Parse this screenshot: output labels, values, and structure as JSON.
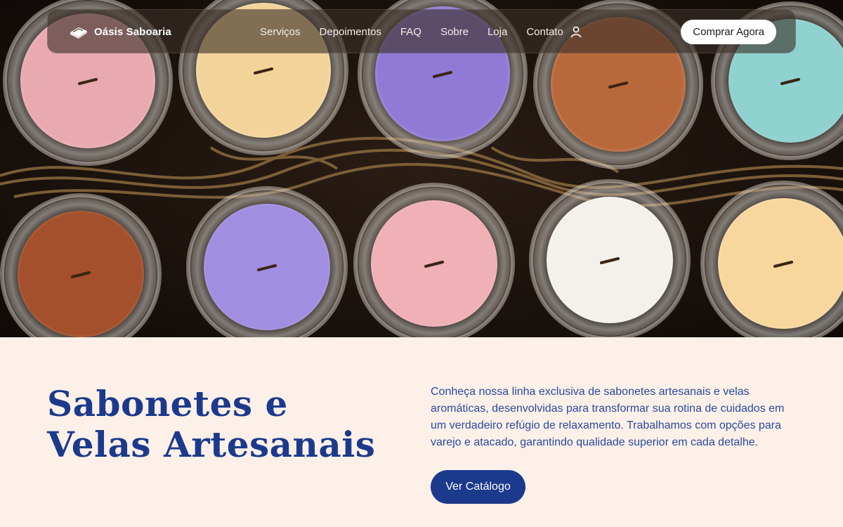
{
  "brand": {
    "name": "Oásis Saboaria",
    "logo_icon": "soap-bar-icon"
  },
  "nav": {
    "links": [
      "Serviços",
      "Depoimentos",
      "FAQ",
      "Sobre",
      "Loja",
      "Contato"
    ],
    "user_icon": "user-icon",
    "cta_label": "Comprar Agora"
  },
  "hero": {
    "image_subject": "candle-jars-photo",
    "colors": [
      "#e8a9b0",
      "#f2d39a",
      "#8f7ad6",
      "#b8683a",
      "#8fd2cf",
      "#a4502c",
      "#a08fe0",
      "#efb0b6",
      "#f4f1ec",
      "#f7d79d"
    ]
  },
  "content": {
    "headline_line1": "Sabonetes e",
    "headline_line2": "Velas Artesanais",
    "description": "Conheça nossa linha exclusiva de sabonetes artesanais e velas aromáticas, desenvolvidas para transformar sua rotina de cuidados em um verdadeiro refúgio de relaxamento. Trabalhamos com opções para varejo e atacado, garantindo qualidade superior em cada detalhe.",
    "button_label": "Ver Catálogo"
  },
  "theme": {
    "accent": "#1c3a8c",
    "background": "#fdf0e8"
  }
}
